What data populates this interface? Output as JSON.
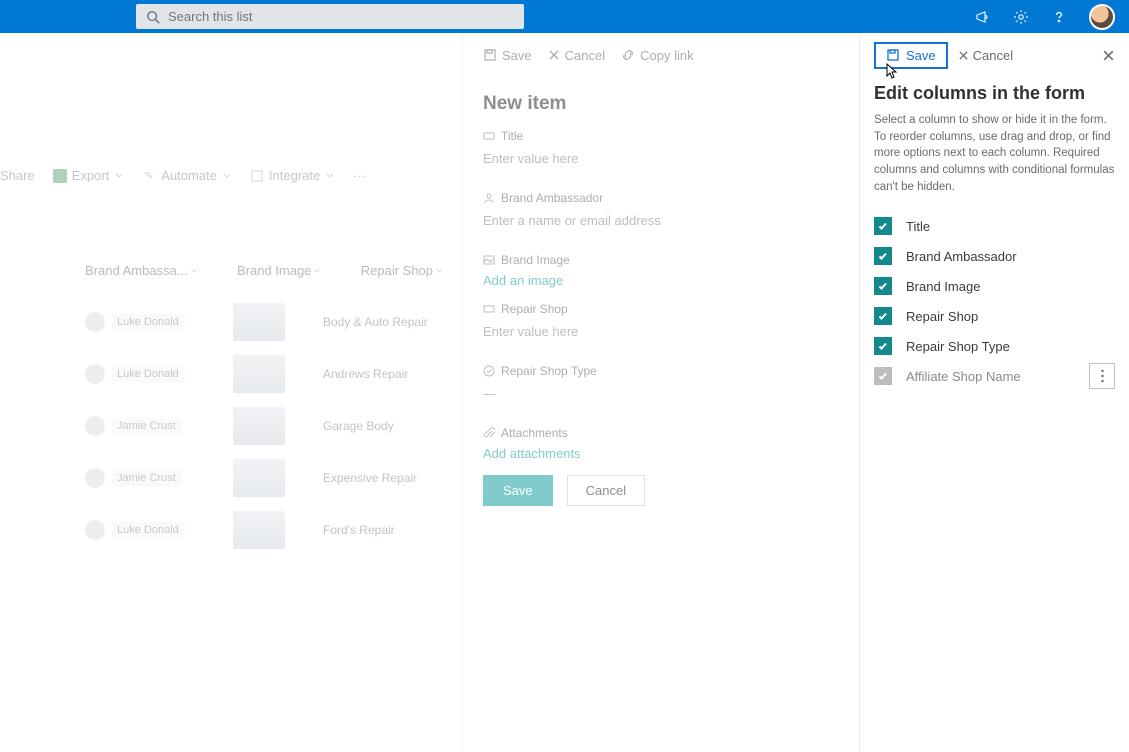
{
  "header": {
    "search_placeholder": "Search this list"
  },
  "list": {
    "toolbar": {
      "share": "Share",
      "export": "Export",
      "automate": "Automate",
      "integrate": "Integrate"
    },
    "columns": {
      "brand_ambassador": "Brand Ambassa...",
      "brand_image": "Brand Image",
      "repair_shop": "Repair Shop"
    },
    "rows": [
      {
        "person": "Luke Donald",
        "repair": "Body & Auto Repair"
      },
      {
        "person": "Luke Donald",
        "repair": "Andrews Repair"
      },
      {
        "person": "Jamie Crust",
        "repair": "Garage Body"
      },
      {
        "person": "Jamie Crust",
        "repair": "Expensive Repair"
      },
      {
        "person": "Luke Donald",
        "repair": "Ford's Repair"
      }
    ]
  },
  "newitem": {
    "cmd": {
      "save": "Save",
      "cancel": "Cancel",
      "copylink": "Copy link"
    },
    "title": "New item",
    "fields": {
      "title_label": "Title",
      "title_placeholder": "Enter value here",
      "ambassador_label": "Brand Ambassador",
      "ambassador_placeholder": "Enter a name or email address",
      "image_label": "Brand Image",
      "image_action": "Add an image",
      "shop_label": "Repair Shop",
      "shop_placeholder": "Enter value here",
      "shoptype_label": "Repair Shop Type",
      "shoptype_value": "—",
      "attachments_label": "Attachments",
      "attachments_action": "Add attachments"
    },
    "buttons": {
      "save": "Save",
      "cancel": "Cancel"
    }
  },
  "editcols": {
    "cmd": {
      "save": "Save",
      "cancel": "Cancel"
    },
    "title": "Edit columns in the form",
    "description": "Select a column to show or hide it in the form. To reorder columns, use drag and drop, or find more options next to each column. Required columns and columns with conditional formulas can't be hidden.",
    "columns": [
      {
        "label": "Title",
        "checked": true
      },
      {
        "label": "Brand Ambassador",
        "checked": true
      },
      {
        "label": "Brand Image",
        "checked": true
      },
      {
        "label": "Repair Shop",
        "checked": true
      },
      {
        "label": "Repair Shop Type",
        "checked": true
      },
      {
        "label": "Affiliate Shop Name",
        "checked": true,
        "disabled": true,
        "has_more": true
      }
    ]
  }
}
